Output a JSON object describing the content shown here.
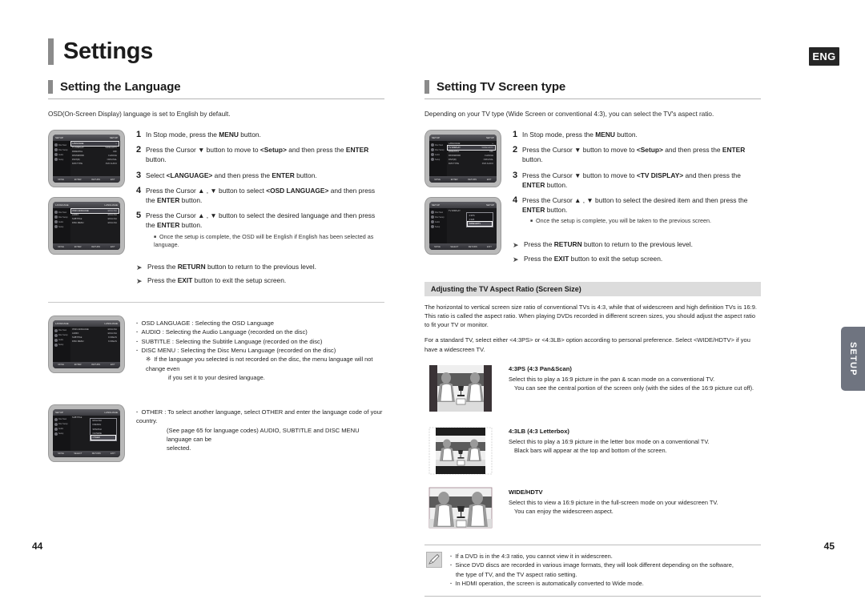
{
  "header": {
    "title": "Settings",
    "lang_badge": "ENG",
    "side_tab": "SETUP"
  },
  "pages": {
    "left": "44",
    "right": "45"
  },
  "left": {
    "section_title": "Setting the Language",
    "lead": "OSD(On-Screen Display) language is set to English by default.",
    "steps": [
      {
        "num": "1",
        "html": "In Stop mode, press the <b>MENU</b> button."
      },
      {
        "num": "2",
        "html": "Press the Cursor ▼ button to move to <b>&lt;Setup&gt;</b> and then press the <b>ENTER</b> button."
      },
      {
        "num": "3",
        "html": "Select <b>&lt;LANGUAGE&gt;</b> and then press the <b>ENTER</b> button."
      },
      {
        "num": "4",
        "html": "Press the Cursor ▲ , ▼ button to select <b>&lt;OSD LANGUAGE&gt;</b> and then press the <b>ENTER</b> button."
      },
      {
        "num": "5",
        "html": "Press the Cursor ▲ , ▼ button to select the desired language and then press the <b>ENTER</b> button.",
        "note": "Once the setup is complete, the OSD will be English if English has been selected as language."
      }
    ],
    "arrow_notes": [
      "Press the <b>RETURN</b> button to return to the previous level.",
      "Press the <b>EXIT</b> button to exit the setup screen."
    ],
    "bullets": [
      "OSD LANGUAGE : Selecting the OSD Language",
      "AUDIO : Selecting the Audio Language (recorded on the disc)",
      "SUBTITLE : Selecting the Subtitle Language (recorded on the disc)",
      "DISC MENU : Selecting the Disc Menu Language (recorded on the disc)"
    ],
    "bullet_sub": "If the language you selected is not recorded on the disc, the menu language will not change even",
    "bullet_sub2": "if you set it to your desired language.",
    "other_bullet": "OTHER : To select another language, select OTHER and enter the language code of your country.",
    "other_cont1": "(See page 65 for language codes) AUDIO, SUBTITLE and DISC MENU language can be",
    "other_cont2": "selected."
  },
  "right": {
    "section_title": "Setting TV Screen type",
    "lead": "Depending on your TV type (Wide Screen  or conventional 4:3), you can select the TV's aspect ratio.",
    "steps": [
      {
        "num": "1",
        "html": "In Stop mode, press the <b>MENU</b> button."
      },
      {
        "num": "2",
        "html": "Press the Cursor ▼ button to move to <b>&lt;Setup&gt;</b> and then press the <b>ENTER</b> button."
      },
      {
        "num": "3",
        "html": "Press the Cursor ▼ button to move to <b>&lt;TV DISPLAY&gt;</b> and then press the <b>ENTER</b> button."
      },
      {
        "num": "4",
        "html": "Press the Cursor ▲ , ▼ button to select the desired item and then press the <b>ENTER</b> button.",
        "note": "Once the setup is complete, you will be taken to the previous screen."
      }
    ],
    "arrow_notes": [
      "Press the <b>RETURN</b> button to return to the previous level.",
      "Press the <b>EXIT</b> button to exit the setup screen."
    ],
    "band_title": "Adjusting the TV Aspect Ratio (Screen Size)",
    "para1": "The horizontal to vertical screen size ratio of conventional TVs is 4:3, while that of widescreen and high definition TVs is 16:9. This ratio is called the aspect ratio. When playing DVDs recorded in different screen sizes, you should adjust the aspect ratio to fit your TV or monitor.",
    "para2": "For a standard TV, select either <4:3PS> or <4:3LB> option according to personal preference. Select <WIDE/HDTV> if you have a widescreen TV.",
    "aspects": [
      {
        "title": "4:3PS (4:3 Pan&Scan)",
        "line1": "Select this to play a 16:9 picture in the pan & scan mode on a conventional TV.",
        "line2": "You can see the central portion of the screen only (with the sides of the 16:9 picture cut off)."
      },
      {
        "title": "4:3LB (4:3 Letterbox)",
        "line1": "Select this to play a 16:9 picture in the letter box mode on a conventional TV.",
        "line2": "Black bars will appear at the top and bottom of the screen."
      },
      {
        "title": "WIDE/HDTV",
        "line1": "Select this to view a 16:9 picture in the full-screen mode on your widescreen TV.",
        "line2": "You can enjoy the widescreen aspect."
      }
    ],
    "notes": [
      "If a DVD is in the 4:3 ratio, you cannot view it in widescreen.",
      "Since DVD discs are recorded in various image formats, they will look different depending on the software,",
      "the type of TV, and the TV aspect ratio setting.",
      "In HDMI operation, the screen is automatically converted to Wide mode."
    ]
  },
  "osd_screens": {
    "setup_main": {
      "header_left": "SETUP",
      "header_right": "SETUP",
      "side": [
        "Disc Navi",
        "Disc Setup",
        "Audio",
        "Setup"
      ],
      "rows": [
        {
          "label": "LANGUAGE",
          "value": "",
          "hl": true
        },
        {
          "label": "TV DISPLAY",
          "value": "WIDE/HDTV"
        },
        {
          "label": "PARENTAL",
          "value": "OFF"
        },
        {
          "label": "PASSWORD",
          "value": "CHANGE"
        },
        {
          "label": "DIVX(R)",
          "value": "ORIGINAL"
        },
        {
          "label": "DVD TYPE",
          "value": "DVD AUDIO"
        }
      ],
      "footer": [
        "MOVE",
        "ENTER",
        "RETURN",
        "EXIT"
      ]
    },
    "setup_tvdisplay": {
      "header_left": "SETUP",
      "header_right": "SETUP",
      "rows": [
        {
          "label": "LANGUAGE",
          "value": ""
        },
        {
          "label": "TV DISPLAY",
          "value": "WIDE/HDTV",
          "hl": true
        },
        {
          "label": "PARENTAL",
          "value": "OFF"
        },
        {
          "label": "PASSWORD",
          "value": "CHANGE"
        },
        {
          "label": "DIVX(R)",
          "value": "ORIGINAL"
        },
        {
          "label": "DVD TYPE",
          "value": "DVD AUDIO"
        }
      ],
      "footer": [
        "MOVE",
        "ENTER",
        "RETURN",
        "EXIT"
      ]
    },
    "language_menu": {
      "header_left": "LANGUAGE",
      "header_right": "LANGUAGE",
      "rows": [
        {
          "label": "OSD LANGUAGE",
          "value": "ENGLISH",
          "hl": true
        },
        {
          "label": "AUDIO",
          "value": "ENGLISH"
        },
        {
          "label": "SUBTITLE",
          "value": "ENGLISH"
        },
        {
          "label": "DISC MENU",
          "value": "ENGLISH"
        }
      ],
      "footer": [
        "MOVE",
        "ENTER",
        "RETURN",
        "EXIT"
      ]
    },
    "osd_language": {
      "header_left": "LANGUAGE",
      "header_right": "LANGUAGE",
      "rows": [
        {
          "label": "OSD LANGUAGE",
          "value": "ENGLISH",
          "hl": true
        },
        {
          "label": "AUDIO",
          "value": "ENGLISH"
        },
        {
          "label": "SUBTITLE",
          "value": "KOREAN"
        },
        {
          "label": "DISC MENU",
          "value": "KOREAN"
        }
      ],
      "footer": [
        "MOVE",
        "ENTER",
        "RETURN",
        "EXIT"
      ]
    },
    "other_popup": {
      "header_left": "SETUP",
      "header_right": "LANGUAGE",
      "label": "SUBTITLE",
      "options": [
        "ENGLISH",
        "FRENCH",
        "SPANISH",
        "CHINESE"
      ],
      "selected": "OTHER",
      "footer": [
        "MOVE",
        "SELECT",
        "RETURN",
        "EXIT"
      ]
    },
    "tv_display_popup": {
      "header_left": "SETUP",
      "header_right": "SETUP",
      "label": "TV DISPLAY",
      "options": [
        "4:3PS",
        "4:3LB"
      ],
      "selected": "WIDE/HDTV",
      "footer": [
        "MOVE",
        "SELECT",
        "RETURN",
        "EXIT"
      ]
    }
  }
}
